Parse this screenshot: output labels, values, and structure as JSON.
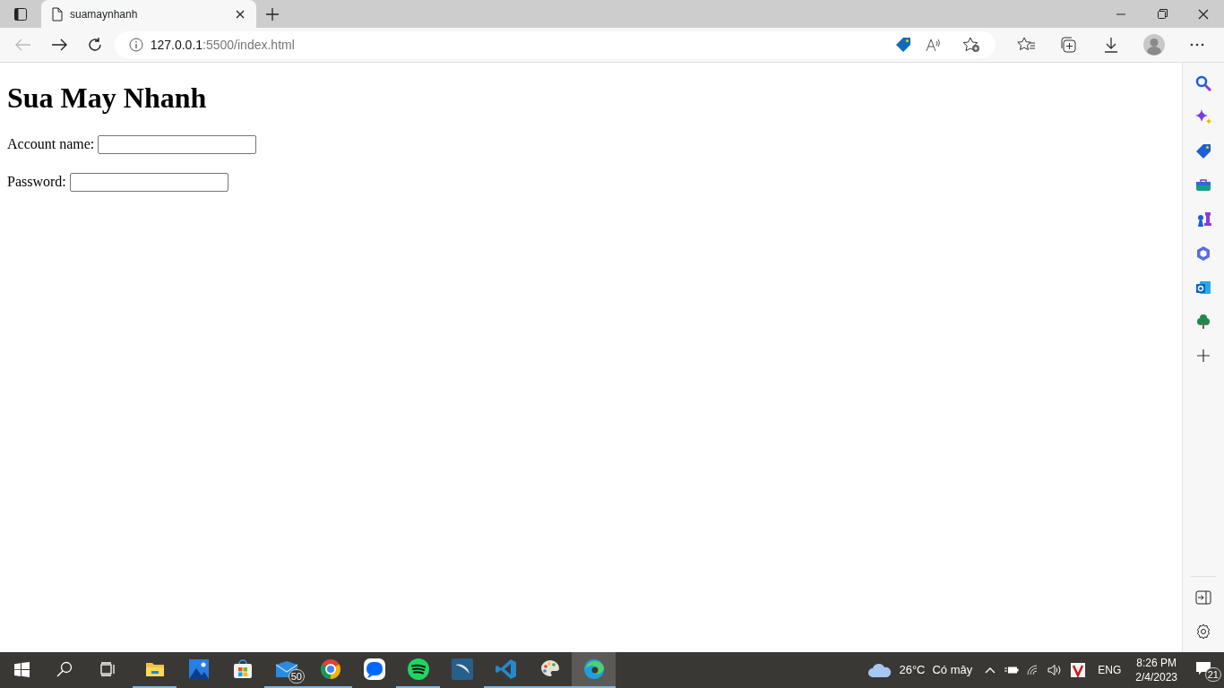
{
  "browser": {
    "tab": {
      "title": "suamaynhanh",
      "selected": true
    },
    "address": {
      "host": "127.0.0.1",
      "path": ":5500/index.html"
    }
  },
  "page": {
    "heading": "Sua May Nhanh",
    "fields": [
      {
        "label": "Account name:"
      },
      {
        "label": "Password:"
      }
    ]
  },
  "taskbar": {
    "apps": [
      {
        "running": true,
        "selected": false
      },
      {
        "running": false,
        "selected": false
      },
      {
        "running": false,
        "selected": false
      },
      {
        "running": true,
        "selected": false,
        "badge": "50"
      },
      {
        "running": true,
        "selected": false
      },
      {
        "running": false,
        "selected": false
      },
      {
        "running": true,
        "selected": false
      },
      {
        "running": false,
        "selected": false
      },
      {
        "running": true,
        "selected": false
      },
      {
        "running": true,
        "selected": false
      },
      {
        "running": true,
        "selected": true
      }
    ],
    "weather": {
      "temperature": "26°C",
      "condition": "Có mây"
    },
    "language": "ENG",
    "time": "8:26 PM",
    "date": "2/4/2023",
    "notifications": "21"
  }
}
